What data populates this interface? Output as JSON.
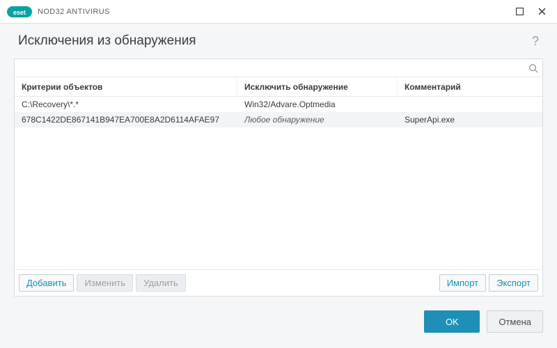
{
  "window": {
    "product_name": "NOD32 ANTIVIRUS",
    "brand_short": "eset"
  },
  "page": {
    "title": "Исключения из обнаружения",
    "help_symbol": "?"
  },
  "search": {
    "value": "",
    "placeholder": ""
  },
  "table": {
    "columns": {
      "criteria": "Критерии объектов",
      "exclude": "Исключить обнаружение",
      "comment": "Комментарий"
    },
    "rows": [
      {
        "criteria": "C:\\Recovery\\*.*",
        "exclude": "Win32/Advare.Optmedia",
        "exclude_italic": false,
        "comment": ""
      },
      {
        "criteria": "678C1422DE867141B947EA700E8A2D6114AFAE97",
        "exclude": "Любое обнаружение",
        "exclude_italic": true,
        "comment": "SuperApi.exe"
      }
    ]
  },
  "actions": {
    "add": "Добавить",
    "edit": "Изменить",
    "delete": "Удалить",
    "import": "Импорт",
    "export": "Экспорт"
  },
  "footer": {
    "ok": "OK",
    "cancel": "Отмена"
  }
}
